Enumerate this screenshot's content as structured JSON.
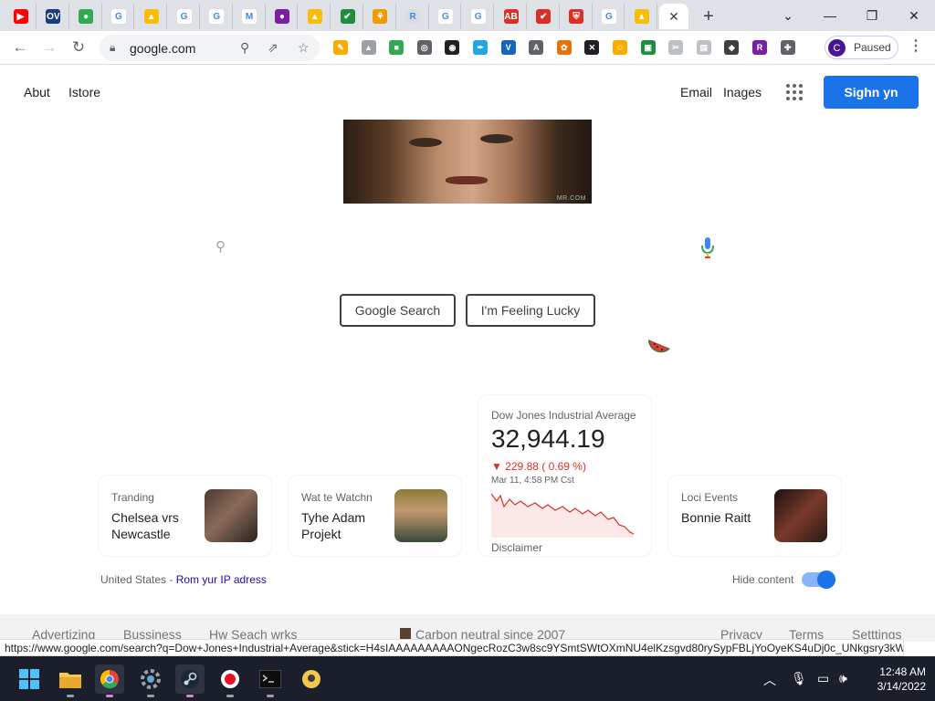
{
  "browser": {
    "tabs": [
      {
        "name": "youtube",
        "color": "#ff0000",
        "glyph": "▶"
      },
      {
        "name": "ov",
        "color": "#1a3d7c",
        "glyph": "OV"
      },
      {
        "name": "messages",
        "color": "#34a853",
        "glyph": "●"
      },
      {
        "name": "google",
        "color": "#ffffff",
        "glyph": "G"
      },
      {
        "name": "drive",
        "color": "#fbbc04",
        "glyph": "▲"
      },
      {
        "name": "google",
        "color": "#ffffff",
        "glyph": "G"
      },
      {
        "name": "google",
        "color": "#ffffff",
        "glyph": "G"
      },
      {
        "name": "gmail",
        "color": "#ffffff",
        "glyph": "M"
      },
      {
        "name": "extension",
        "color": "#7b1fa2",
        "glyph": "●"
      },
      {
        "name": "drive",
        "color": "#fbbc04",
        "glyph": "▲"
      },
      {
        "name": "check",
        "color": "#1e8e3e",
        "glyph": "✔"
      },
      {
        "name": "app",
        "color": "#f29900",
        "glyph": "⚘"
      },
      {
        "name": "app",
        "color": "#dadce0",
        "glyph": "R"
      },
      {
        "name": "google",
        "color": "#ffffff",
        "glyph": "G"
      },
      {
        "name": "google",
        "color": "#ffffff",
        "glyph": "G"
      },
      {
        "name": "app",
        "color": "#d93025",
        "glyph": "AB"
      },
      {
        "name": "todoist",
        "color": "#d93025",
        "glyph": "✔"
      },
      {
        "name": "shield",
        "color": "#d93025",
        "glyph": "⛨"
      },
      {
        "name": "google",
        "color": "#ffffff",
        "glyph": "G"
      },
      {
        "name": "drive",
        "color": "#fbbc04",
        "glyph": "▲"
      }
    ],
    "new_tab_glyph": "+",
    "window_controls": {
      "chevron": "⌄",
      "minimize": "—",
      "restore": "❐",
      "close": "✕"
    },
    "omnibox": {
      "url": "google.com"
    },
    "profile": {
      "initial": "C",
      "status": "Paused"
    }
  },
  "page": {
    "header": {
      "about": "Abut",
      "store": "Istore",
      "email": "Email",
      "images": "Inages",
      "sign_in": "Sighn yn"
    },
    "doodle": {
      "watermark": "MR.COM"
    },
    "search": {
      "value": ""
    },
    "buttons": {
      "search": "Google Search",
      "lucky": "I'm Feeling Lucky"
    },
    "cards": {
      "trending": {
        "title": "Tranding",
        "body": "Chelsea vrs Newcastle"
      },
      "watching": {
        "title": "Wat te Watchn",
        "body": "Tyhe Adam Projekt"
      },
      "events": {
        "title": "Loci Events",
        "body": "Bonnie Raitt"
      }
    },
    "stock": {
      "name": "Dow Jones Industrial Average",
      "value": "32,944.19",
      "change": "▼ 229.88  ( 0.69 %)",
      "date": "Mar 11, 4:58 PM Cst",
      "disclaimer": "Disclaimer",
      "line_color": "#d93025",
      "fill_color": "#fce8e6"
    },
    "location": {
      "country": "United States",
      "sep": " - ",
      "ip_link": "Rom yur IP adress"
    },
    "hide_content": "Hide content",
    "footer": {
      "advertising": "Advertizing",
      "business": "Bussiness",
      "how": "Hw Seach wrks",
      "carbon": "Carbon neutral since 2007",
      "privacy": "Privacy",
      "terms": "Terms",
      "settings": "Setttings"
    },
    "status_url": "https://www.google.com/search?q=Dow+Jones+Industrial+Average&stick=H4sIAAAAAAAAAONgecRozC3w8sc9YSmtSWtOXmNU4elKzsgvd80rySypFBLjYoOyeKS4uDj0c_UNkgsry3kWs..."
  },
  "taskbar": {
    "time": "12:48 AM",
    "date": "3/14/2022"
  },
  "colors": {
    "accent": "#1a73e8",
    "taskbar": "#1a1f2b"
  }
}
